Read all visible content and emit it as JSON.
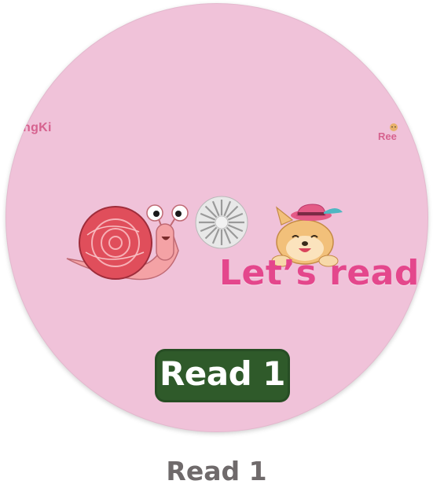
{
  "thumbnail": {
    "watermark_left": "ngKi",
    "watermark_right": "Ree",
    "headline": "Let’s read!",
    "badge_label": "Read 1",
    "caption": "Read 1",
    "icons": [
      "snail-icon",
      "loading-spinner-icon",
      "puppy-with-hat-icon"
    ],
    "colors": {
      "circle_background": "#f0c2d9",
      "headline": "#e4478c",
      "badge_background": "#2f5a2a",
      "badge_text": "#ffffff",
      "caption": "#6f6a6b"
    }
  }
}
